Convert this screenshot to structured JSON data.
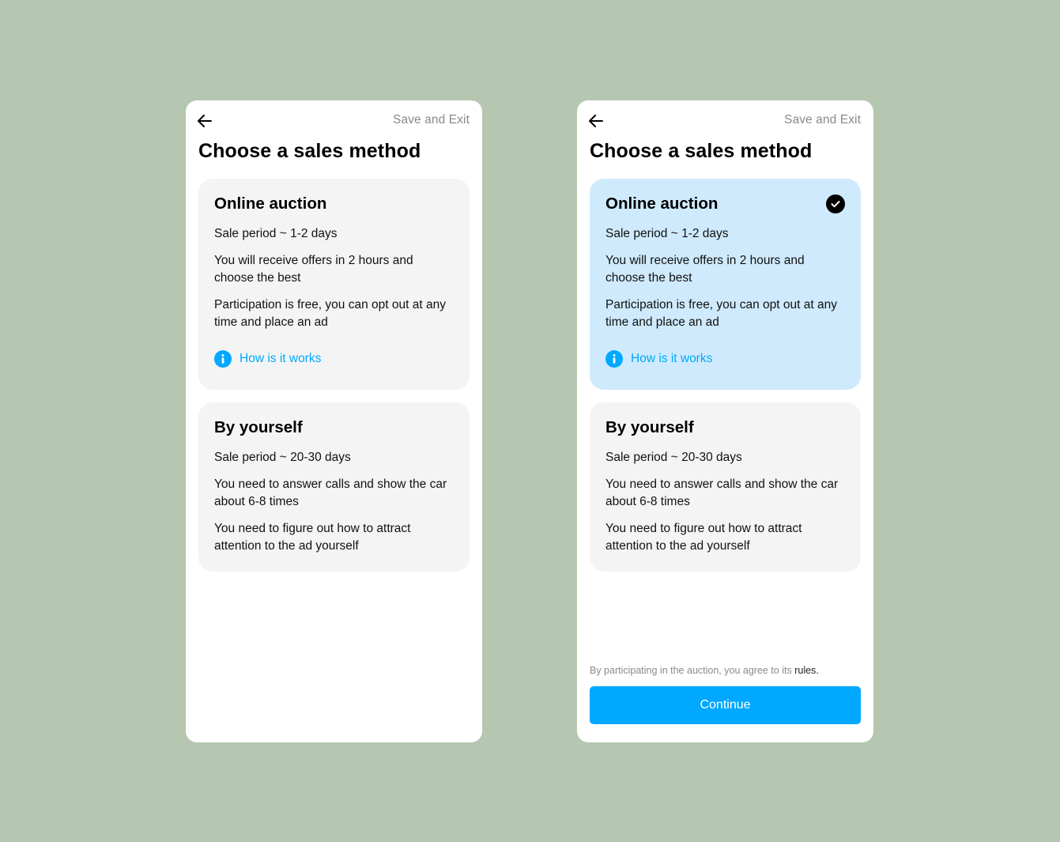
{
  "colors": {
    "background": "#b5c6b1",
    "accent": "#00a8ff",
    "selected_card": "#cfeafc",
    "card": "#f4f4f4"
  },
  "screens": [
    {
      "state": "default",
      "header": {
        "back_icon": "arrow-left-icon",
        "save_exit": "Save and Exit"
      },
      "title": "Choose a sales method",
      "auction": {
        "selected": false,
        "title": "Online auction",
        "lines": [
          "Sale period ~ 1-2 days",
          "You will receive offers in 2 hours and choose the best",
          "Participation is free, you can opt out at any time and place an ad"
        ],
        "how_icon": "info-icon",
        "how_label": "How is it works"
      },
      "self": {
        "title": "By yourself",
        "lines": [
          "Sale period ~ 20-30 days",
          "You need to answer calls and show the car about 6-8 times",
          "You need to figure out how to attract attention to the ad yourself"
        ]
      }
    },
    {
      "state": "auction-selected",
      "header": {
        "back_icon": "arrow-left-icon",
        "save_exit": "Save and Exit"
      },
      "title": "Choose a sales method",
      "auction": {
        "selected": true,
        "check_icon": "checkmark-icon",
        "title": "Online auction",
        "lines": [
          "Sale period ~ 1-2 days",
          "You will receive offers in 2 hours and choose the best",
          "Participation is free, you can opt out at any time and place an ad"
        ],
        "how_icon": "info-icon",
        "how_label": "How is it works"
      },
      "self": {
        "title": "By yourself",
        "lines": [
          "Sale period ~ 20-30 days",
          "You need to answer calls and show the car about 6-8 times",
          "You need to figure out how to attract attention to the ad yourself"
        ]
      },
      "footer": {
        "agree_text": "By participating in the auction, you agree to its",
        "rules_link": "rules.",
        "continue_label": "Continue"
      }
    }
  ]
}
